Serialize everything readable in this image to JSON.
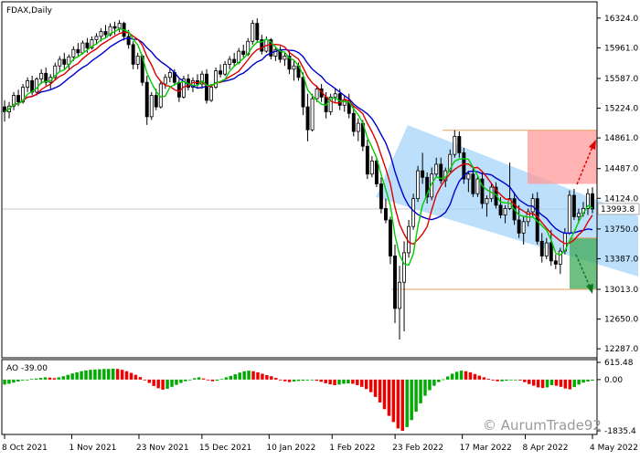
{
  "chart_data": [
    {
      "type": "candlestick",
      "title": "FDAX,Daily",
      "y_ticks": [
        "16324.0",
        "15961.0",
        "15587.0",
        "15224.0",
        "14861.0",
        "14487.0",
        "14124.0",
        "13750.0",
        "13387.0",
        "13013.0",
        "12650.0",
        "12287.0"
      ],
      "x_ticks": [
        "8 Oct 2021",
        "1 Nov 2021",
        "23 Nov 2021",
        "15 Dec 2021",
        "10 Jan 2022",
        "1 Feb 2022",
        "23 Feb 2022",
        "17 Mar 2022",
        "8 Apr 2022",
        "4 May 2022"
      ],
      "ylim": [
        12200,
        16500
      ],
      "current_price": "13993.8",
      "levels": [
        14954,
        13013
      ],
      "ohlc": [
        [
          15240,
          15320,
          15060,
          15180
        ],
        [
          15180,
          15300,
          15100,
          15250
        ],
        [
          15250,
          15420,
          15200,
          15380
        ],
        [
          15380,
          15450,
          15250,
          15300
        ],
        [
          15300,
          15520,
          15280,
          15480
        ],
        [
          15480,
          15600,
          15420,
          15560
        ],
        [
          15560,
          15620,
          15380,
          15420
        ],
        [
          15420,
          15600,
          15380,
          15580
        ],
        [
          15580,
          15700,
          15520,
          15650
        ],
        [
          15650,
          15720,
          15500,
          15540
        ],
        [
          15540,
          15640,
          15460,
          15600
        ],
        [
          15600,
          15780,
          15560,
          15740
        ],
        [
          15740,
          15860,
          15680,
          15820
        ],
        [
          15820,
          15900,
          15700,
          15760
        ],
        [
          15760,
          15880,
          15700,
          15850
        ],
        [
          15850,
          15980,
          15800,
          15940
        ],
        [
          15940,
          16020,
          15860,
          15900
        ],
        [
          15900,
          16050,
          15880,
          16020
        ],
        [
          16020,
          16080,
          15900,
          15960
        ],
        [
          15960,
          16100,
          15940,
          16060
        ],
        [
          16060,
          16140,
          16000,
          16100
        ],
        [
          16100,
          16200,
          16040,
          16160
        ],
        [
          16160,
          16240,
          16080,
          16120
        ],
        [
          16120,
          16260,
          16100,
          16220
        ],
        [
          16220,
          16280,
          16120,
          16200
        ],
        [
          16200,
          16300,
          16150,
          16260
        ],
        [
          16260,
          16280,
          16050,
          16100
        ],
        [
          16100,
          16180,
          15950,
          16000
        ],
        [
          16000,
          16040,
          15700,
          15760
        ],
        [
          15760,
          15900,
          15700,
          15860
        ],
        [
          15860,
          15880,
          15500,
          15540
        ],
        [
          15540,
          15620,
          15020,
          15120
        ],
        [
          15120,
          15420,
          15080,
          15380
        ],
        [
          15380,
          15460,
          15200,
          15240
        ],
        [
          15240,
          15560,
          15220,
          15520
        ],
        [
          15520,
          15640,
          15460,
          15600
        ],
        [
          15600,
          15720,
          15540,
          15660
        ],
        [
          15660,
          15700,
          15500,
          15540
        ],
        [
          15540,
          15580,
          15300,
          15360
        ],
        [
          15360,
          15620,
          15340,
          15580
        ],
        [
          15580,
          15640,
          15440,
          15480
        ],
        [
          15480,
          15600,
          15420,
          15560
        ],
        [
          15560,
          15640,
          15460,
          15520
        ],
        [
          15520,
          15680,
          15460,
          15640
        ],
        [
          15640,
          15700,
          15280,
          15320
        ],
        [
          15320,
          15520,
          15300,
          15480
        ],
        [
          15480,
          15720,
          15460,
          15680
        ],
        [
          15680,
          15760,
          15600,
          15640
        ],
        [
          15640,
          15800,
          15620,
          15760
        ],
        [
          15760,
          15860,
          15700,
          15820
        ],
        [
          15820,
          15900,
          15740,
          15780
        ],
        [
          15780,
          15960,
          15760,
          15920
        ],
        [
          15920,
          16000,
          15840,
          15880
        ],
        [
          15880,
          16080,
          15860,
          16040
        ],
        [
          16040,
          16300,
          16000,
          16260
        ],
        [
          16260,
          16320,
          16020,
          16060
        ],
        [
          16060,
          16120,
          15880,
          15920
        ],
        [
          15920,
          16100,
          15900,
          16060
        ],
        [
          16060,
          16080,
          15820,
          15860
        ],
        [
          15860,
          15980,
          15800,
          15940
        ],
        [
          15940,
          15980,
          15780,
          15820
        ],
        [
          15820,
          15900,
          15740,
          15860
        ],
        [
          15860,
          15920,
          15640,
          15700
        ],
        [
          15700,
          15800,
          15560,
          15740
        ],
        [
          15740,
          15780,
          15560,
          15600
        ],
        [
          15600,
          15660,
          15140,
          15240
        ],
        [
          15240,
          15400,
          14820,
          14960
        ],
        [
          14960,
          15400,
          14940,
          15340
        ],
        [
          15340,
          15500,
          15300,
          15460
        ],
        [
          15460,
          15520,
          15300,
          15360
        ],
        [
          15360,
          15420,
          15100,
          15180
        ],
        [
          15180,
          15400,
          15140,
          15360
        ],
        [
          15360,
          15460,
          15300,
          15400
        ],
        [
          15400,
          15460,
          15200,
          15260
        ],
        [
          15260,
          15380,
          15180,
          15320
        ],
        [
          15320,
          15400,
          15100,
          15160
        ],
        [
          15160,
          15260,
          14880,
          14940
        ],
        [
          14940,
          15100,
          14820,
          15040
        ],
        [
          15040,
          15080,
          14700,
          14760
        ],
        [
          14760,
          14840,
          14360,
          14420
        ],
        [
          14420,
          14640,
          14380,
          14580
        ],
        [
          14580,
          14620,
          14260,
          14300
        ],
        [
          14300,
          14380,
          13940,
          14000
        ],
        [
          14000,
          14120,
          13820,
          13860
        ],
        [
          13860,
          13900,
          13320,
          13420
        ],
        [
          13420,
          13560,
          12600,
          12780
        ],
        [
          12780,
          13300,
          12400,
          13100
        ],
        [
          13100,
          13600,
          12500,
          13460
        ],
        [
          13460,
          13860,
          13400,
          13780
        ],
        [
          13780,
          14180,
          13740,
          14120
        ],
        [
          14120,
          14520,
          14080,
          14460
        ],
        [
          14460,
          14680,
          14300,
          14380
        ],
        [
          14380,
          14440,
          14060,
          14140
        ],
        [
          14140,
          14500,
          14100,
          14420
        ],
        [
          14420,
          14620,
          14380,
          14540
        ],
        [
          14540,
          14620,
          14300,
          14340
        ],
        [
          14340,
          14500,
          14260,
          14460
        ],
        [
          14460,
          14720,
          14440,
          14660
        ],
        [
          14660,
          14954,
          14620,
          14880
        ],
        [
          14880,
          14940,
          14620,
          14680
        ],
        [
          14680,
          14740,
          14300,
          14360
        ],
        [
          14360,
          14460,
          14200,
          14420
        ],
        [
          14420,
          14500,
          14140,
          14180
        ],
        [
          14180,
          14400,
          14140,
          14360
        ],
        [
          14360,
          14440,
          14000,
          14060
        ],
        [
          14060,
          14160,
          13900,
          14120
        ],
        [
          14120,
          14300,
          14080,
          14260
        ],
        [
          14260,
          14320,
          14000,
          14040
        ],
        [
          14040,
          14140,
          13880,
          13920
        ],
        [
          13920,
          14040,
          13820,
          14000
        ],
        [
          14000,
          14560,
          13980,
          14120
        ],
        [
          14120,
          14200,
          13800,
          13860
        ],
        [
          13860,
          14040,
          13640,
          13700
        ],
        [
          13700,
          13900,
          13560,
          13840
        ],
        [
          13840,
          14000,
          13780,
          13960
        ],
        [
          13960,
          14180,
          13900,
          14120
        ],
        [
          14120,
          14200,
          13560,
          13600
        ],
        [
          13600,
          13700,
          13340,
          13420
        ],
        [
          13420,
          13640,
          13380,
          13580
        ],
        [
          13580,
          13740,
          13300,
          13360
        ],
        [
          13360,
          13440,
          13260,
          13320
        ],
        [
          13320,
          13520,
          13200,
          13480
        ],
        [
          13480,
          13760,
          13440,
          13700
        ],
        [
          13700,
          14220,
          13680,
          14160
        ],
        [
          14160,
          14240,
          13860,
          13900
        ],
        [
          13900,
          14000,
          13820,
          13940
        ],
        [
          13940,
          14080,
          13900,
          14000
        ],
        [
          14000,
          14240,
          13920,
          14180
        ],
        [
          14180,
          14260,
          13940,
          13994
        ]
      ]
    },
    {
      "type": "bar",
      "title": "AO -39.00",
      "y_ticks": [
        "615.48",
        "0.00",
        "-1835.4"
      ],
      "ylim": [
        -1900,
        650
      ],
      "values": [
        -180,
        -150,
        -110,
        -70,
        -30,
        -5,
        20,
        40,
        60,
        80,
        70,
        50,
        80,
        120,
        170,
        220,
        260,
        300,
        330,
        350,
        360,
        370,
        380,
        380,
        390,
        380,
        350,
        300,
        240,
        170,
        90,
        -20,
        -120,
        -230,
        -310,
        -360,
        -330,
        -260,
        -190,
        -120,
        -60,
        0,
        50,
        80,
        40,
        -10,
        -60,
        -40,
        20,
        80,
        130,
        190,
        250,
        300,
        320,
        300,
        260,
        210,
        160,
        120,
        60,
        0,
        -60,
        -90,
        -70,
        -50,
        -40,
        -30,
        -20,
        -40,
        -80,
        -130,
        -170,
        -200,
        -180,
        -150,
        -140,
        -150,
        -200,
        -260,
        -340,
        -450,
        -620,
        -820,
        -1060,
        -1300,
        -1520,
        -1750,
        -1835,
        -1700,
        -1450,
        -1150,
        -850,
        -580,
        -380,
        -220,
        -90,
        10,
        110,
        210,
        280,
        320,
        300,
        260,
        200,
        140,
        80,
        30,
        -30,
        -60,
        -60,
        -40,
        -20,
        0,
        -30,
        -90,
        -160,
        -220,
        -280,
        -300,
        -280,
        -200,
        -220,
        -260,
        -320,
        -350,
        -270,
        -180,
        -110,
        -70,
        -39
      ]
    }
  ],
  "watermark": "© AurumTrade92"
}
